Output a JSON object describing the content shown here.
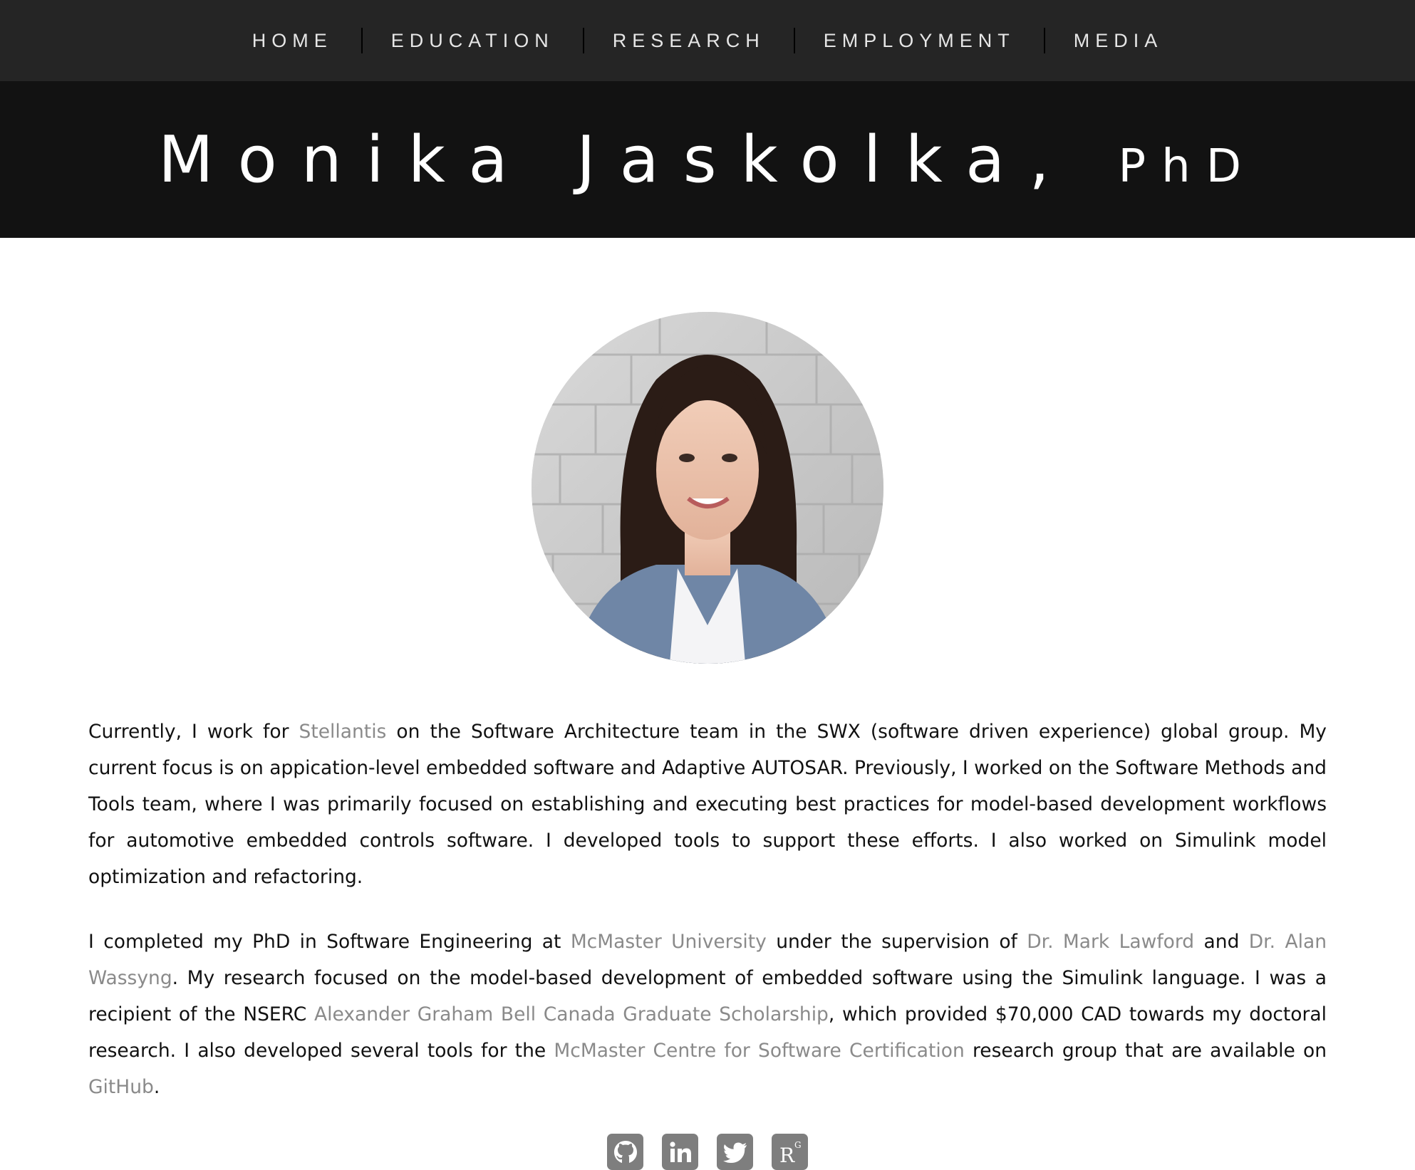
{
  "nav": {
    "items": [
      {
        "label": "HOME"
      },
      {
        "label": "EDUCATION"
      },
      {
        "label": "RESEARCH"
      },
      {
        "label": "EMPLOYMENT"
      },
      {
        "label": "MEDIA"
      }
    ]
  },
  "banner": {
    "name": "Monika Jaskolka,",
    "suffix": "PhD"
  },
  "portrait": {
    "icon": "portrait-photo"
  },
  "bio": {
    "p1": {
      "t1": "Currently, I work for ",
      "link_stellantis": "Stellantis",
      "t2": " on the Software Architecture team in the SWX (software driven experience) global group. My current focus is on appication-level embedded software and Adaptive AUTOSAR. Previously, I worked on the Software Methods and Tools team, where I was primarily focused on establishing and executing best practices for model-based development workflows for automotive embedded controls software. I developed tools to support these efforts. I also worked on Simulink model optimization and refactoring."
    },
    "p2": {
      "t1": "I completed my PhD in Software Engineering at ",
      "link_mcmaster": "McMaster University",
      "t2": " under the supervision of ",
      "link_lawford": "Dr. Mark Lawford",
      "t3": " and ",
      "link_wassyng": "Dr. Alan Wassyng",
      "t4": ". My research focused on the model-based development of embedded software using the Simulink language. I was a recipient of the NSERC ",
      "link_scholarship": "Alexander Graham Bell Canada Graduate Scholarship",
      "t5": ", which provided $70,000 CAD towards my doctoral research. I also developed several tools for the ",
      "link_centre": "McMaster Centre for Software Certification",
      "t6": " research group that are available on ",
      "link_github": "GitHub",
      "t7": "."
    }
  },
  "social": {
    "researchgate_text": "R",
    "researchgate_sup": "G",
    "icons": [
      "github-icon",
      "linkedin-icon",
      "twitter-icon",
      "researchgate-icon"
    ]
  },
  "colors": {
    "nav_bg": "#252525",
    "banner_bg": "#121212",
    "link": "#8a8a8a",
    "icon_bg": "#7e7e7e"
  }
}
